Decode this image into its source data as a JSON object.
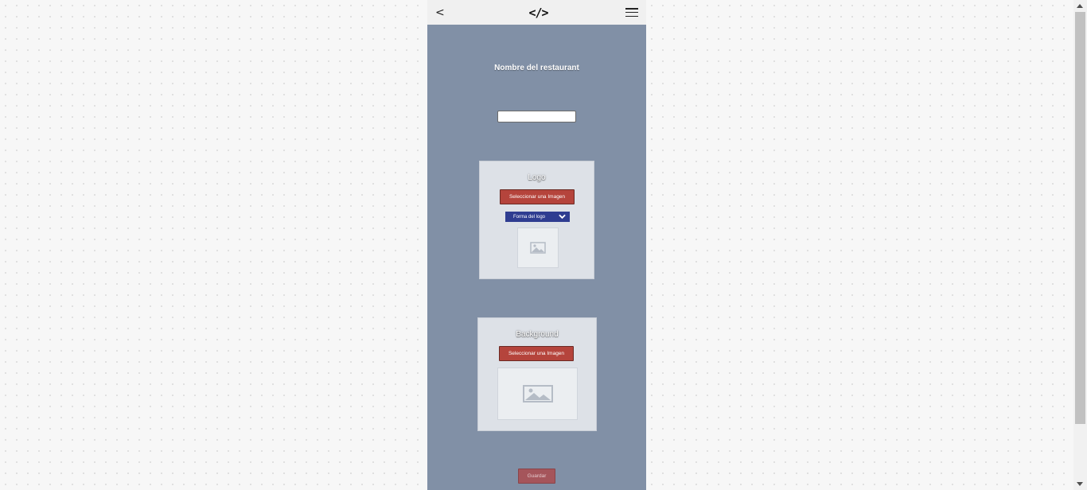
{
  "topbar": {
    "back_label": "<",
    "brand_label": "</>",
    "menu_icon": "hamburger-icon"
  },
  "form": {
    "name_label": "Nombre del restaurant",
    "name_value": ""
  },
  "logo_section": {
    "title": "Logo",
    "select_image_label": "Seleccionar una Imagen",
    "shape_select_value": "Forma del logo",
    "preview_icon": "image-placeholder-icon"
  },
  "background_section": {
    "title": "Background",
    "select_image_label": "Seleccionar una Imagen",
    "preview_icon": "image-placeholder-icon"
  },
  "save_label": "Guardar",
  "colors": {
    "page_bg": "#8190a6",
    "red_button": "#b5443c",
    "select_blue": "#2f3d91",
    "save_button": "#a5555b"
  }
}
